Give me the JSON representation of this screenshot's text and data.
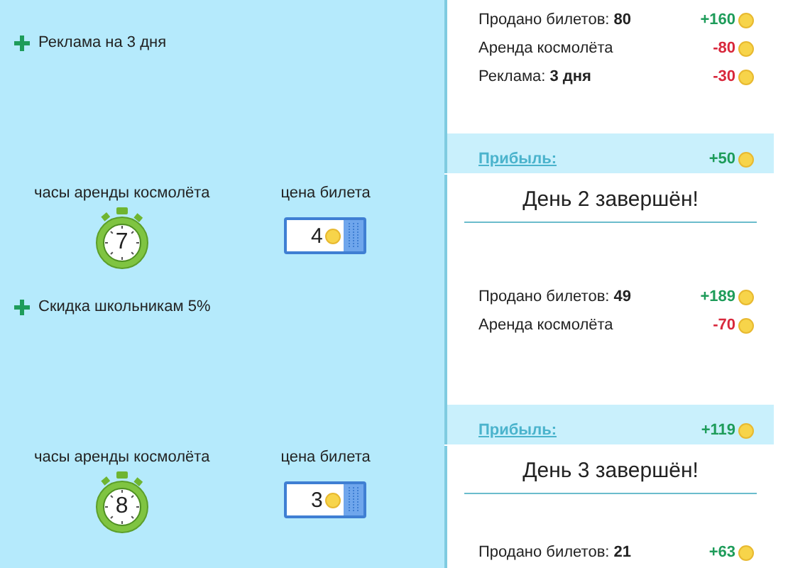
{
  "rounds": [
    {
      "bonus": "Реклама на 3 дня",
      "hours_label": "часы аренды космолёта",
      "hours": "7",
      "price_label": "цена билета",
      "price": "4"
    },
    {
      "bonus": "Скидка школьникам 5%",
      "hours_label": "часы аренды космолёта",
      "hours": "8",
      "price_label": "цена билета",
      "price": "3"
    }
  ],
  "reports": [
    {
      "items": [
        {
          "label": "Продано билетов: **80**",
          "amount": "+160",
          "kind": "income"
        },
        {
          "label": "Аренда космолёта",
          "amount": "-80",
          "kind": "expense"
        },
        {
          "label": "Реклама: **3 дня**",
          "amount": "-30",
          "kind": "expense"
        }
      ],
      "profit_label": "Прибыль:",
      "profit": "+50"
    },
    {
      "title": "День 2 завершён!",
      "items": [
        {
          "label": "Продано билетов: **49**",
          "amount": "+189",
          "kind": "income"
        },
        {
          "label": "Аренда космолёта",
          "amount": "-70",
          "kind": "expense"
        }
      ],
      "profit_label": "Прибыль:",
      "profit": "+119"
    },
    {
      "title": "День 3 завершён!",
      "items": [
        {
          "label": "Продано билетов: **21**",
          "amount": "+63",
          "kind": "income"
        }
      ]
    }
  ]
}
